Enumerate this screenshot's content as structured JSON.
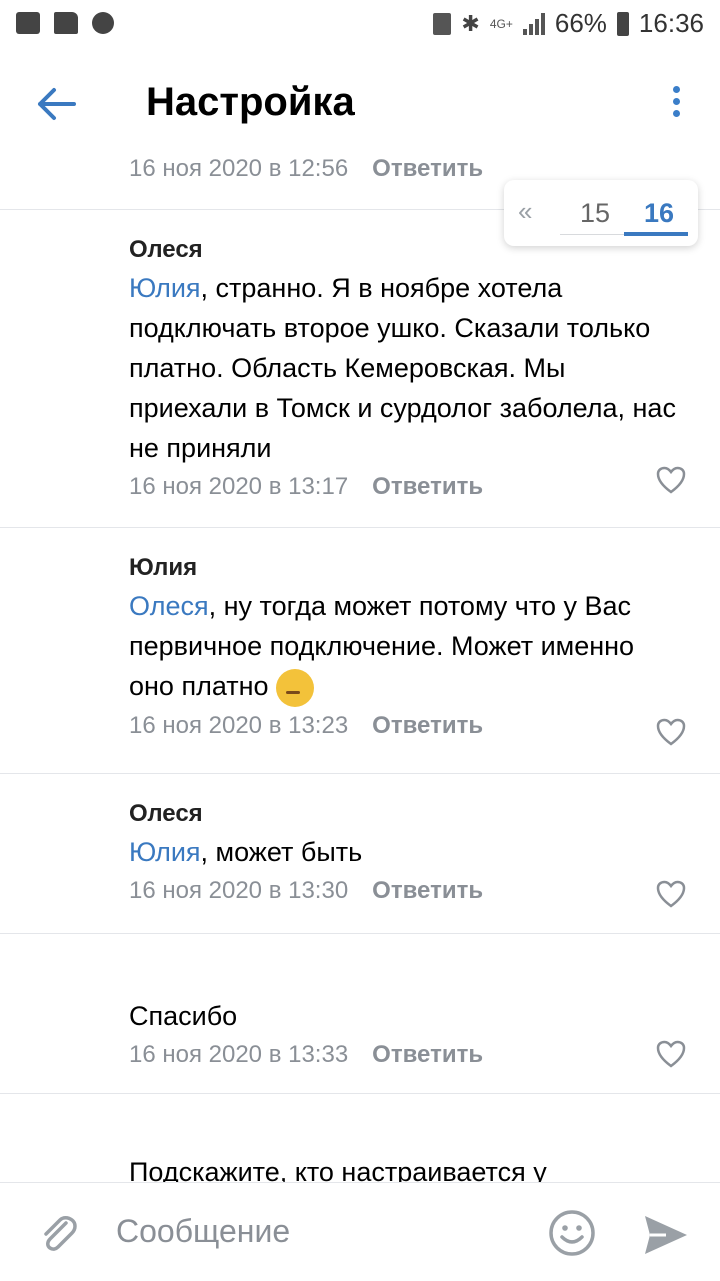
{
  "status_bar": {
    "battery": "66%",
    "time": "16:36",
    "network": "4G+"
  },
  "header": {
    "title": "Настройка"
  },
  "pager": {
    "prev_symbol": "«",
    "pages": [
      "15",
      "16"
    ],
    "current": "16"
  },
  "comments": [
    {
      "author": "",
      "mention": "",
      "text": "",
      "date": "16 ноя 2020 в 12:56",
      "reply": "Ответить"
    },
    {
      "author": "Олеся",
      "mention": "Юлия",
      "text": ", странно. Я в ноябре хотела подключать второе ушко. Сказали только платно. Область Кемеровская. Мы приехали в Томск и сурдолог заболела, нас не приняли",
      "date": "16 ноя 2020 в 13:17",
      "reply": "Ответить"
    },
    {
      "author": "Юлия",
      "mention": "Олеся",
      "text": ", ну тогда может потому что у Вас первичное  подключение. Может именно оно платно",
      "date": "16 ноя 2020 в 13:23",
      "reply": "Ответить"
    },
    {
      "author": "Олеся",
      "mention": "Юлия",
      "text": ", может быть",
      "date": "16 ноя 2020 в 13:30",
      "reply": "Ответить"
    },
    {
      "author": "",
      "mention": "",
      "text": "Спасибо",
      "date": "16 ноя 2020 в 13:33",
      "reply": "Ответить"
    },
    {
      "author": "",
      "mention": "",
      "text": "Подскажите, кто настраивается у",
      "date": "",
      "reply": ""
    }
  ],
  "composer": {
    "placeholder": "Сообщение"
  },
  "icons": {
    "back": "arrow-left-icon",
    "menu": "kebab-icon",
    "like": "heart-icon",
    "attach": "paperclip-icon",
    "emoji": "smile-icon",
    "send": "send-icon",
    "thinking": "thinking-face-icon"
  },
  "colors": {
    "accent": "#3a79c0",
    "meta": "#8a8f96"
  }
}
